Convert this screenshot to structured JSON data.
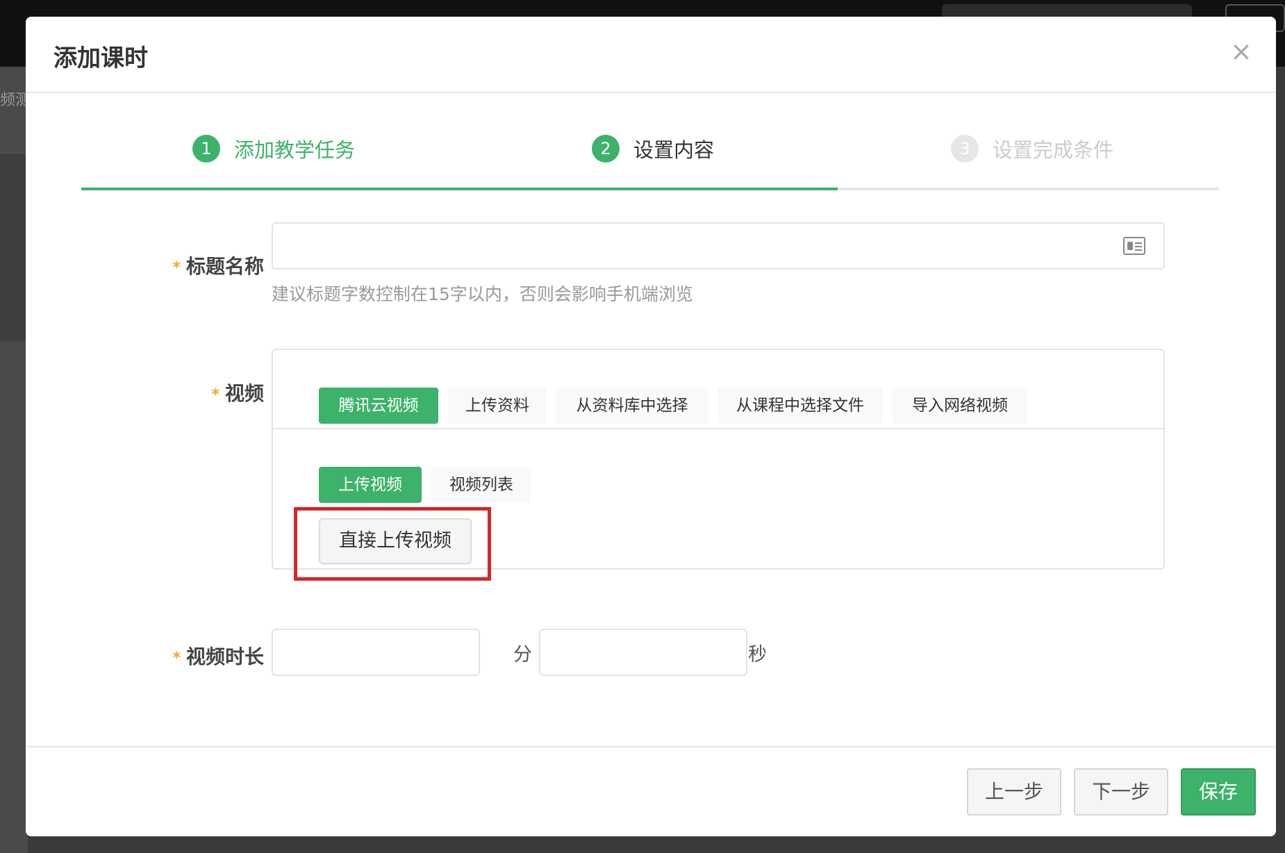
{
  "background": {
    "side_fragment": "频测"
  },
  "modal": {
    "title": "添加课时",
    "close_glyph": "×"
  },
  "steps": [
    {
      "number": "1",
      "label": "添加教学任务",
      "state": "done"
    },
    {
      "number": "2",
      "label": "设置内容",
      "state": "current"
    },
    {
      "number": "3",
      "label": "设置完成条件",
      "state": "pending"
    }
  ],
  "step_progress_fraction": 0.665,
  "form": {
    "title": {
      "label": "标题名称",
      "value": "",
      "hint": "建议标题字数控制在15字以内，否则会影响手机端浏览"
    },
    "video": {
      "label": "视频",
      "source_tabs": [
        "腾讯云视频",
        "上传资料",
        "从资料库中选择",
        "从课程中选择文件",
        "导入网络视频"
      ],
      "active_source_tab": 0,
      "sub_tabs": [
        "上传视频",
        "视频列表"
      ],
      "active_sub_tab": 0,
      "upload_button": "直接上传视频"
    },
    "duration": {
      "label": "视频时长",
      "minutes_value": "",
      "minutes_unit": "分",
      "seconds_value": "",
      "seconds_unit": "秒"
    }
  },
  "footer": {
    "prev_label": "上一步",
    "next_label": "下一步",
    "save_label": "保存"
  },
  "colors": {
    "accent": "#3db26a",
    "required_star": "#f5a623",
    "highlight": "#d92626"
  }
}
